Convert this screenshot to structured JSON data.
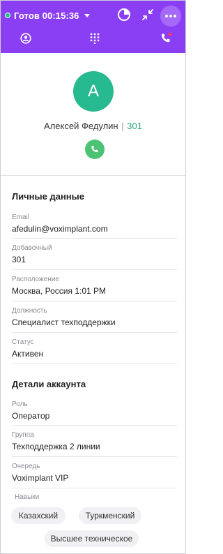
{
  "header": {
    "status_label": "Готов 00:15:36",
    "status_color": "#21c47a",
    "background": "#8b3ff5",
    "icons": [
      "stats-pie-icon",
      "minimize-arrows-icon",
      "more-dots-icon",
      "contacts-icon",
      "dialpad-icon",
      "calls-icon"
    ]
  },
  "profile": {
    "avatar_letter": "А",
    "avatar_color": "#27b98f",
    "name": "Алексей Федулин",
    "separator": "|",
    "extension": "301",
    "call_icon": "phone-icon"
  },
  "personal": {
    "title": "Личные данные",
    "fields": [
      {
        "label": "Email",
        "value": "afedulin@voximplant.com"
      },
      {
        "label": "Добавочный",
        "value": "301"
      },
      {
        "label": "Расположение",
        "value": "Москва, Россия 1:01 PM"
      },
      {
        "label": "Должность",
        "value": "Специалист техподдержки"
      },
      {
        "label": "Статус",
        "value": "Активен"
      }
    ]
  },
  "account": {
    "title": "Детали аккаунта",
    "fields": [
      {
        "label": "Роль",
        "value": "Оператор"
      },
      {
        "label": "Группа",
        "value": "Техподдержка 2 линии"
      },
      {
        "label": "Очередь",
        "value": "Voximplant VIP"
      }
    ],
    "skills_label": "Навыки",
    "skills": [
      "Казахский",
      "Туркменский",
      "Высшее техническое"
    ]
  }
}
